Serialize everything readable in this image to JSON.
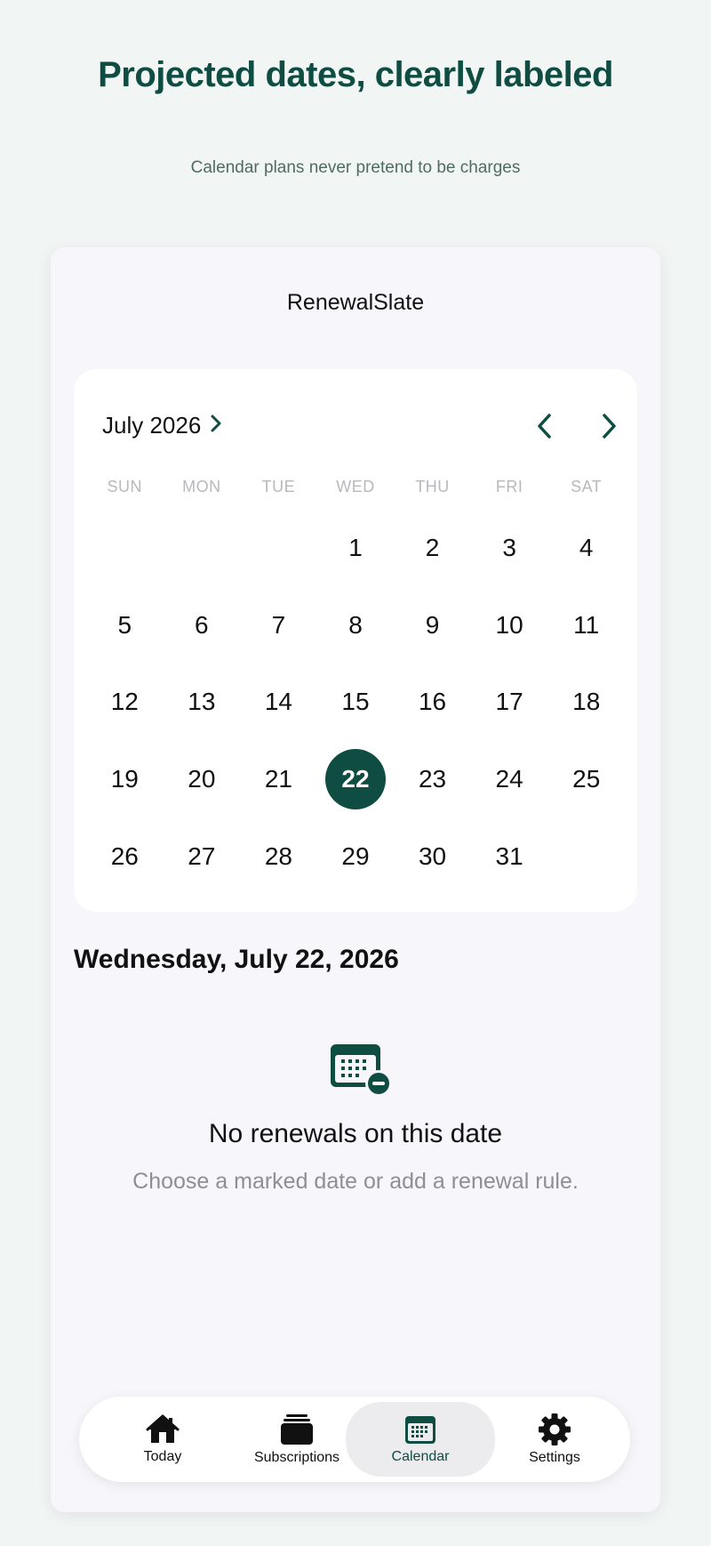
{
  "header": {
    "title": "Projected dates, clearly labeled",
    "subtitle": "Calendar plans never pretend to be charges"
  },
  "app": {
    "title": "RenewalSlate"
  },
  "calendar": {
    "month_label": "July 2026",
    "weekdays": [
      "SUN",
      "MON",
      "TUE",
      "WED",
      "THU",
      "FRI",
      "SAT"
    ],
    "leading_blanks": 3,
    "days": [
      "1",
      "2",
      "3",
      "4",
      "5",
      "6",
      "7",
      "8",
      "9",
      "10",
      "11",
      "12",
      "13",
      "14",
      "15",
      "16",
      "17",
      "18",
      "19",
      "20",
      "21",
      "22",
      "23",
      "24",
      "25",
      "26",
      "27",
      "28",
      "29",
      "30",
      "31"
    ],
    "selected_day": "22"
  },
  "detail": {
    "date_heading": "Wednesday, July 22, 2026",
    "empty_title": "No renewals on this date",
    "empty_subtitle": "Choose a marked date or add a renewal rule."
  },
  "tabbar": {
    "today": "Today",
    "subscriptions": "Subscriptions",
    "calendar": "Calendar",
    "settings": "Settings",
    "active": "calendar"
  },
  "colors": {
    "accent": "#0f4d43",
    "page_bg": "#f1f6f4",
    "card_bg": "#ffffff",
    "muted": "#8e8e93"
  }
}
